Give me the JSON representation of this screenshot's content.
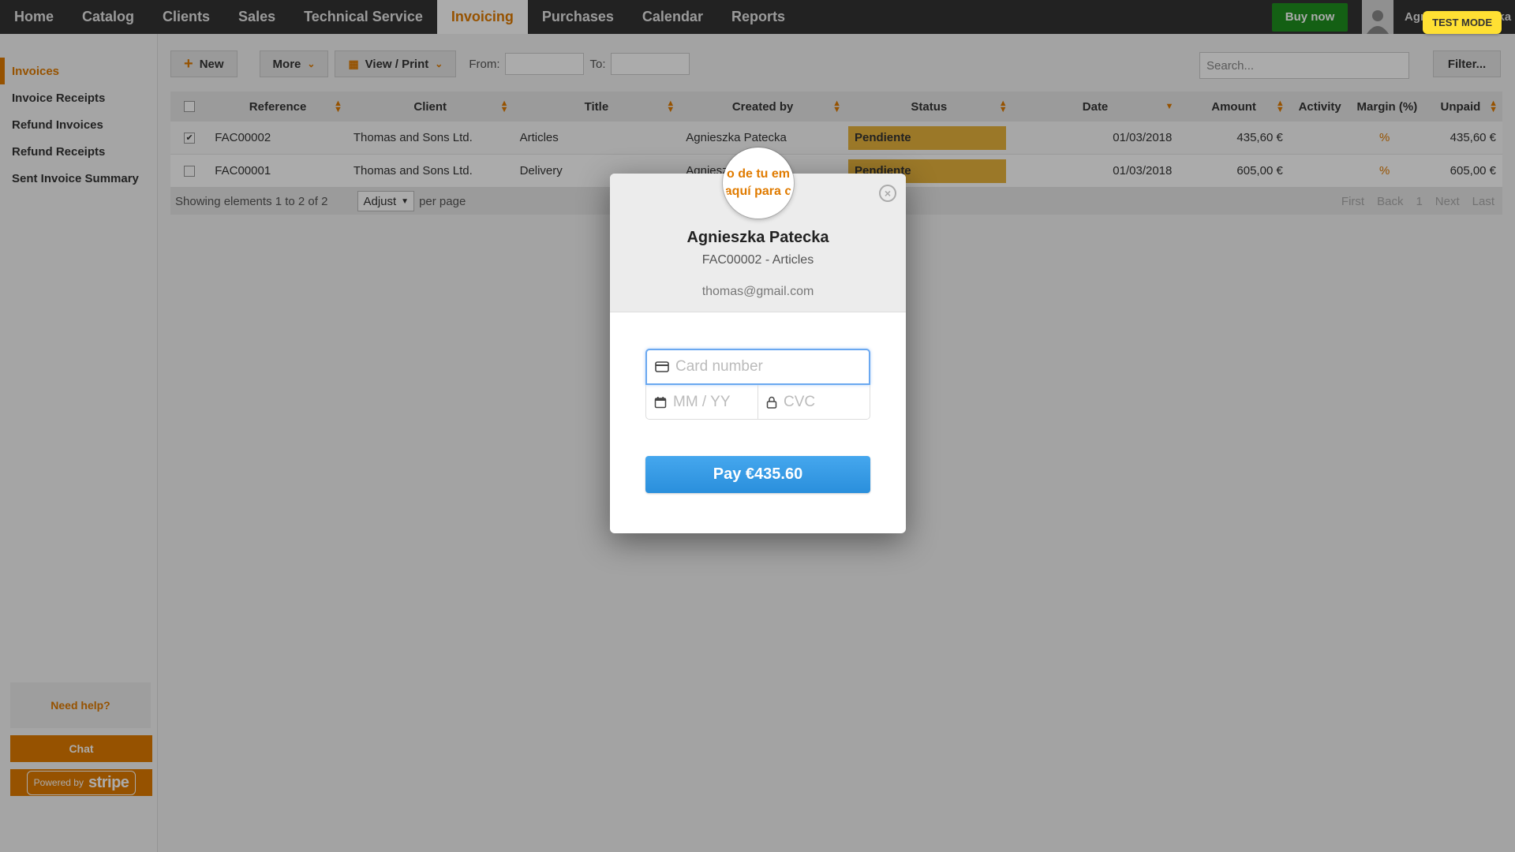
{
  "nav": {
    "items": [
      "Home",
      "Catalog",
      "Clients",
      "Sales",
      "Technical Service",
      "Invoicing",
      "Purchases",
      "Calendar",
      "Reports"
    ],
    "active": "Invoicing",
    "buy_now": "Buy now",
    "user_name": "Agnieszka Patecka",
    "test_mode": "TEST MODE"
  },
  "sidebar": {
    "items": [
      "Invoices",
      "Invoice Receipts",
      "Refund Invoices",
      "Refund Receipts",
      "Sent Invoice Summary"
    ],
    "need_help": "Need help?",
    "chat": "Chat",
    "powered_by": "Powered by",
    "stripe": "stripe"
  },
  "toolbar": {
    "new": "New",
    "more": "More",
    "view_print": "View / Print",
    "from_label": "From:",
    "to_label": "To:",
    "search_placeholder": "Search...",
    "filter": "Filter..."
  },
  "table": {
    "headers": {
      "reference": "Reference",
      "client": "Client",
      "title": "Title",
      "created_by": "Created by",
      "status": "Status",
      "date": "Date",
      "amount": "Amount",
      "activity": "Activity",
      "margin": "Margin (%)",
      "unpaid": "Unpaid"
    },
    "rows": [
      {
        "checked": "✔",
        "reference": "FAC00002",
        "client": "Thomas and Sons Ltd.",
        "title": "Articles",
        "created_by": "Agnieszka Patecka",
        "status": "Pendiente",
        "date": "01/03/2018",
        "amount": "435,60 €",
        "margin": "%",
        "unpaid": "435,60 €"
      },
      {
        "checked": "",
        "reference": "FAC00001",
        "client": "Thomas and Sons Ltd.",
        "title": "Delivery",
        "created_by": "Agnieszka Patecka",
        "status": "Pendiente",
        "date": "01/03/2018",
        "amount": "605,00 €",
        "margin": "%",
        "unpaid": "605,00 €"
      }
    ],
    "footer": {
      "showing": "Showing elements 1 to 2 of 2",
      "adjust": "Adjust",
      "per_page": "per page",
      "first": "First",
      "back": "Back",
      "page": "1",
      "next": "Next",
      "last": "Last"
    }
  },
  "modal": {
    "logo_text_top": "o de tu em",
    "logo_text_bottom": "aquí para c",
    "name": "Agnieszka Patecka",
    "subtitle": "FAC00002 - Articles",
    "email": "thomas@gmail.com",
    "card_placeholder": "Card number",
    "exp_placeholder": "MM / YY",
    "cvc_placeholder": "CVC",
    "pay_label": "Pay €435.60",
    "close": "×"
  },
  "colors": {
    "accent": "#e07b00",
    "nav_bg": "#333333",
    "buy_now": "#1e8f1e",
    "status_pending": "#e8b33c",
    "pay_button": "#2f96e0",
    "test_mode": "#ffe033"
  }
}
